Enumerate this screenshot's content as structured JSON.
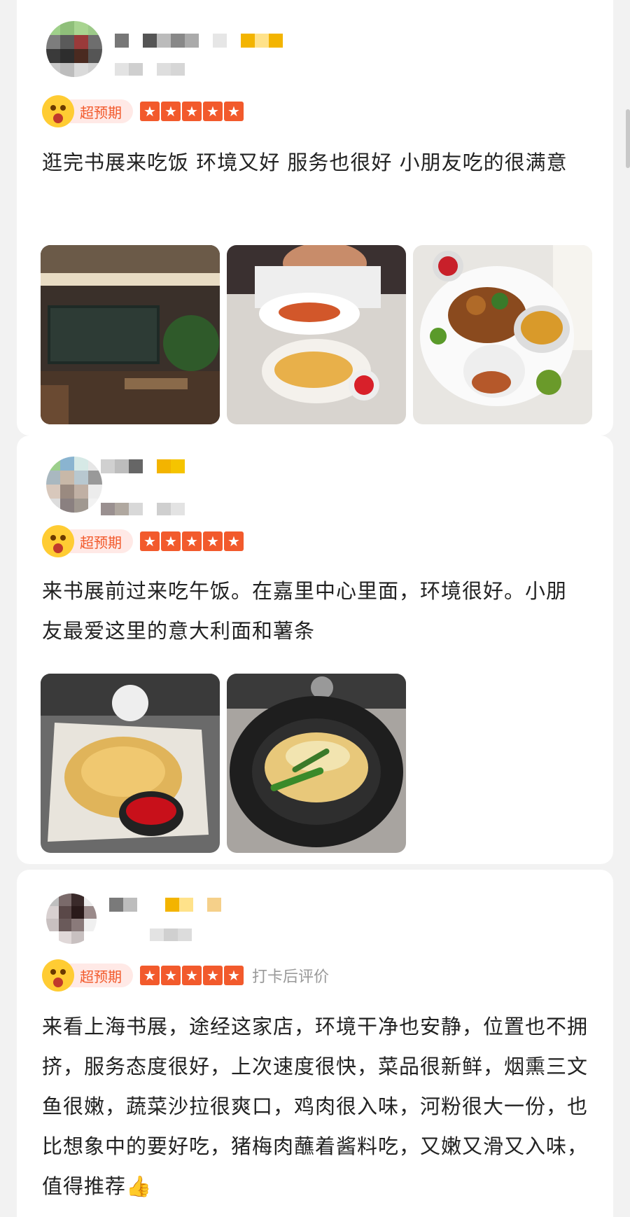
{
  "reviews": [
    {
      "badge_label": "超预期",
      "stars": 5,
      "text": "逛完书展来吃饭  环境又好  服务也很好  小朋友吃的很满意",
      "photos": [
        "restaurant-interior",
        "child-eating-pasta",
        "fried-chicken-plate"
      ]
    },
    {
      "badge_label": "超预期",
      "stars": 5,
      "text": "来书展前过来吃午饭。在嘉里中心里面，环境很好。小朋友最爱这里的意大利面和薯条",
      "photos": [
        "fries-with-ketchup",
        "penne-pasta"
      ]
    },
    {
      "badge_label": "超预期",
      "stars": 5,
      "checkin_label": "打卡后评价",
      "text": "来看上海书展，途经这家店，环境干净也安静，位置也不拥挤，服务态度很好，上次速度很快，菜品很新鲜，烟熏三文鱼很嫩，蔬菜沙拉很爽口，鸡肉很入味，河粉很大一份，也比想象中的要好吃，猪梅肉蘸着酱料吃，又嫩又滑又入味，值得推荐👍"
    }
  ],
  "colors": {
    "accent": "#f25a2c",
    "badge_bg": "#ffe9e6",
    "emoji": "#ffcc33",
    "muted": "#999999"
  },
  "icons": {
    "star": "star-icon",
    "surprised_emoji": "surprised-emoji-icon",
    "thumbs_up": "thumbs-up-emoji"
  }
}
